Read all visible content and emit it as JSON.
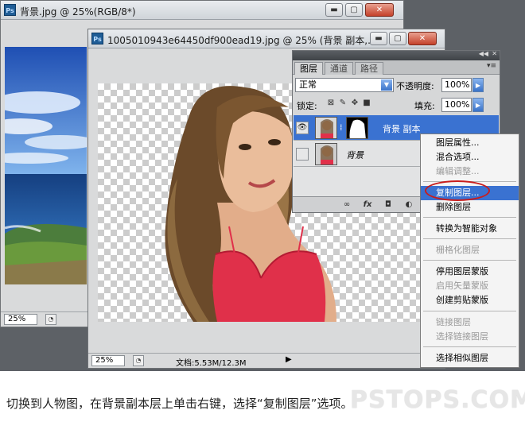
{
  "back_window": {
    "title": "背景.jpg @ 25%(RGB/8*)",
    "zoom": "25%",
    "buttons": {
      "minimize": "▬",
      "maximize": "▢",
      "close": "✕"
    }
  },
  "front_window": {
    "title": "1005010943e64450df900ead19.jpg @ 25% (背景 副本,...",
    "zoom": "25%",
    "doc_info": "文档:5.53M/12.3M",
    "buttons": {
      "minimize": "▬",
      "maximize": "▢",
      "close": "✕"
    }
  },
  "layers_panel": {
    "tabs": [
      "图层",
      "通道",
      "路径"
    ],
    "blend_mode": "正常",
    "opacity_label": "不透明度:",
    "opacity_value": "100%",
    "lock_label": "锁定:",
    "fill_label": "填充:",
    "fill_value": "100%",
    "layers": [
      {
        "name": "背景 副本",
        "selected": true
      },
      {
        "name": "背景",
        "selected": false
      }
    ],
    "bottom_icons": [
      "link-icon",
      "fx-icon",
      "mask-icon",
      "adjustment-icon"
    ]
  },
  "context_menu": {
    "items": [
      {
        "label": "图层属性...",
        "disabled": false
      },
      {
        "label": "混合选项...",
        "disabled": false
      },
      {
        "label": "编辑调整...",
        "disabled": true
      },
      {
        "label": "复制图层...",
        "disabled": false,
        "highlighted": true
      },
      {
        "label": "删除图层",
        "disabled": false
      },
      {
        "label": "转换为智能对象",
        "disabled": false
      },
      {
        "label": "栅格化图层",
        "disabled": true
      },
      {
        "label": "停用图层蒙版",
        "disabled": false
      },
      {
        "label": "启用矢量蒙版",
        "disabled": true
      },
      {
        "label": "创建剪贴蒙版",
        "disabled": false
      },
      {
        "label": "链接图层",
        "disabled": true
      },
      {
        "label": "选择链接图层",
        "disabled": true
      },
      {
        "label": "选择相似图层",
        "disabled": false
      }
    ]
  },
  "caption": "切换到人物图，在背景副本层上单击右键，选择“复制图层”选项。",
  "watermark": "PSTOPS.COM",
  "colors": {
    "highlight": "#3a72d1",
    "annotation_circle": "#c81d1d",
    "bra": "#e0304a"
  }
}
